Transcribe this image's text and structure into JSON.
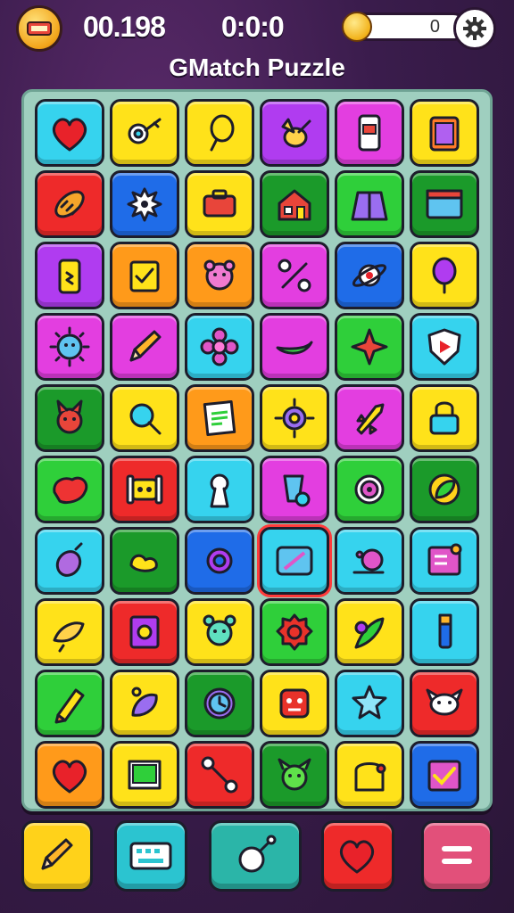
{
  "header": {
    "score": "00.198",
    "timer": "0:0:0",
    "coins": "0",
    "title": "GMatch Puzzle"
  },
  "colors": {
    "red": "#ee2a2a",
    "yellow": "#ffe21a",
    "orange": "#ff9a1a",
    "purple": "#b03cf0",
    "magenta": "#e33ee0",
    "blue": "#1f6ce8",
    "cyan": "#36d3ee",
    "green": "#2fcf3a",
    "dgreen": "#1b9a2a",
    "pink": "#f05aa0",
    "teal": "#2bb5c8"
  },
  "grid": [
    [
      {
        "c": "cyan",
        "i": "heart-icon"
      },
      {
        "c": "yellow",
        "i": "key-icon"
      },
      {
        "c": "yellow",
        "i": "lightbulb-icon"
      },
      {
        "c": "purple",
        "i": "bird-icon"
      },
      {
        "c": "magenta",
        "i": "phone-icon"
      },
      {
        "c": "yellow",
        "i": "clipboard-icon"
      }
    ],
    [
      {
        "c": "red",
        "i": "bread-icon"
      },
      {
        "c": "blue",
        "i": "splat-icon"
      },
      {
        "c": "yellow",
        "i": "toolbox-icon"
      },
      {
        "c": "dgreen",
        "i": "house-icon"
      },
      {
        "c": "green",
        "i": "cape-icon"
      },
      {
        "c": "dgreen",
        "i": "window-icon"
      }
    ],
    [
      {
        "c": "purple",
        "i": "battery-icon"
      },
      {
        "c": "orange",
        "i": "checklist-icon"
      },
      {
        "c": "orange",
        "i": "bear-icon"
      },
      {
        "c": "magenta",
        "i": "wrench-icon"
      },
      {
        "c": "blue",
        "i": "saturn-icon"
      },
      {
        "c": "yellow",
        "i": "balloon-icon"
      }
    ],
    [
      {
        "c": "magenta",
        "i": "sun-face-icon"
      },
      {
        "c": "magenta",
        "i": "pencil-icon"
      },
      {
        "c": "cyan",
        "i": "flower-icon"
      },
      {
        "c": "magenta",
        "i": "leaf-blob-icon"
      },
      {
        "c": "green",
        "i": "star4-icon"
      },
      {
        "c": "cyan",
        "i": "shield-icon"
      }
    ],
    [
      {
        "c": "dgreen",
        "i": "cat-icon"
      },
      {
        "c": "yellow",
        "i": "magnifier-icon"
      },
      {
        "c": "orange",
        "i": "note-icon"
      },
      {
        "c": "yellow",
        "i": "gear-sun-icon"
      },
      {
        "c": "magenta",
        "i": "rocket-icon"
      },
      {
        "c": "yellow",
        "i": "lock-icon"
      }
    ],
    [
      {
        "c": "green",
        "i": "heart-blob-icon"
      },
      {
        "c": "red",
        "i": "robot-icon"
      },
      {
        "c": "cyan",
        "i": "keyhole-icon"
      },
      {
        "c": "magenta",
        "i": "blender-icon"
      },
      {
        "c": "green",
        "i": "target-icon"
      },
      {
        "c": "dgreen",
        "i": "leaf-icon"
      }
    ],
    [
      {
        "c": "cyan",
        "i": "eggplant-icon"
      },
      {
        "c": "dgreen",
        "i": "duck-icon"
      },
      {
        "c": "blue",
        "i": "ring-icon"
      },
      {
        "c": "cyan",
        "i": "tablet-icon",
        "sel": true
      },
      {
        "c": "cyan",
        "i": "snail-icon"
      },
      {
        "c": "cyan",
        "i": "settings-panel-icon"
      }
    ],
    [
      {
        "c": "yellow",
        "i": "hand-icon"
      },
      {
        "c": "red",
        "i": "frame-icon"
      },
      {
        "c": "yellow",
        "i": "alarm-clock-icon"
      },
      {
        "c": "green",
        "i": "rose-icon"
      },
      {
        "c": "yellow",
        "i": "feather-icon"
      },
      {
        "c": "cyan",
        "i": "marker-icon"
      }
    ],
    [
      {
        "c": "green",
        "i": "crayon-icon"
      },
      {
        "c": "yellow",
        "i": "eggplant2-icon"
      },
      {
        "c": "dgreen",
        "i": "clock-icon"
      },
      {
        "c": "yellow",
        "i": "monster-icon"
      },
      {
        "c": "cyan",
        "i": "star-icon"
      },
      {
        "c": "red",
        "i": "owl-icon"
      }
    ],
    [
      {
        "c": "orange",
        "i": "heart2-icon"
      },
      {
        "c": "yellow",
        "i": "book-icon"
      },
      {
        "c": "red",
        "i": "wrench2-icon"
      },
      {
        "c": "dgreen",
        "i": "dragon-icon"
      },
      {
        "c": "yellow",
        "i": "backpack-icon"
      },
      {
        "c": "blue",
        "i": "calendar-check-icon"
      }
    ]
  ],
  "bottom_buttons": [
    {
      "name": "pencil-hint-button",
      "c": "#ffd21a",
      "i": "pencil-icon"
    },
    {
      "name": "keyboard-button",
      "c": "#2bc4d0",
      "i": "keyboard-icon"
    },
    {
      "name": "magic-wand-button",
      "c": "#2bb5a8",
      "i": "wand-icon"
    },
    {
      "name": "favorite-button",
      "c": "#ee2a2a",
      "i": "heart-icon"
    },
    {
      "name": "menu-button",
      "c": "#e2507a",
      "i": "menu-icon"
    }
  ]
}
